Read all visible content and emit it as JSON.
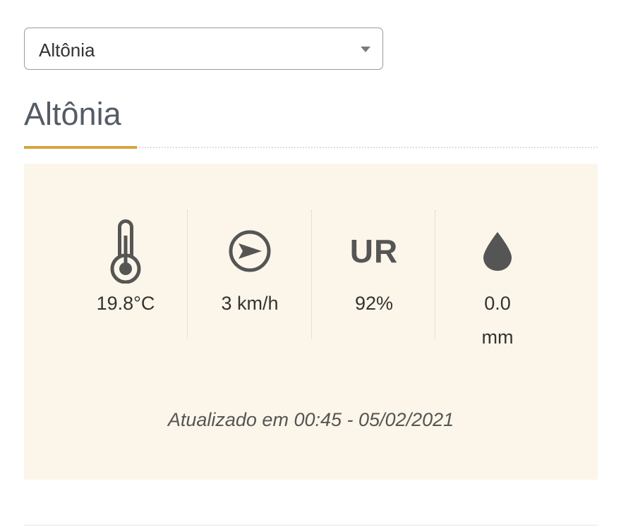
{
  "location_select": {
    "selected": "Altônia"
  },
  "page_title": "Altônia",
  "stats": {
    "temperature": {
      "icon": "thermometer-icon",
      "value": "19.8°C"
    },
    "wind": {
      "icon": "wind-direction-icon",
      "value": "3 km/h"
    },
    "humidity": {
      "icon_text": "UR",
      "value": "92%"
    },
    "rain": {
      "icon": "raindrop-icon",
      "value": "0.0",
      "unit": "mm"
    }
  },
  "updated": "Atualizado em 00:45 - 05/02/2021",
  "colors": {
    "accent": "#d9a441",
    "card_background": "#fbf6e9",
    "icon": "#555555"
  }
}
